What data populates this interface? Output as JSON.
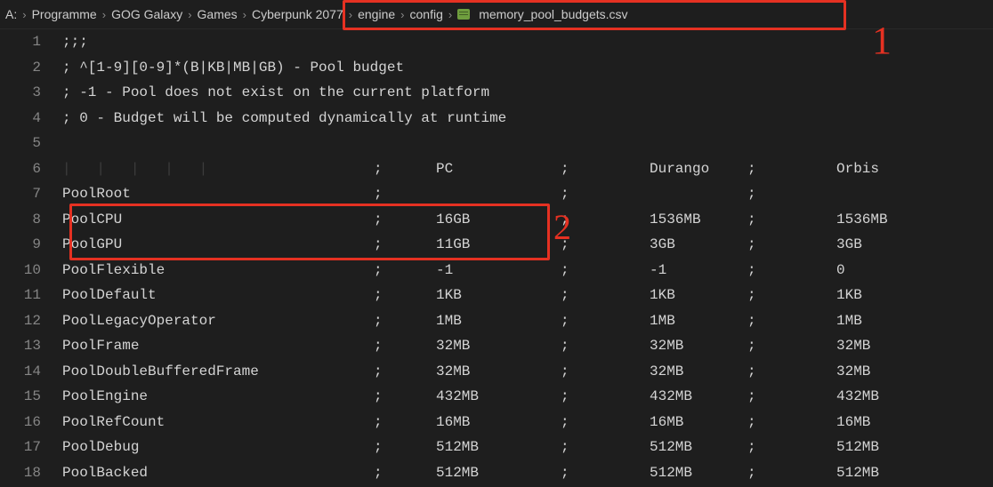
{
  "breadcrumb": {
    "root": "A:",
    "items": [
      "Programme",
      "GOG Galaxy",
      "Games",
      "Cyberpunk 2077",
      "engine",
      "config"
    ],
    "file_icon": "csv-file-icon",
    "file": "memory_pool_budgets.csv",
    "sep_glyph": "›"
  },
  "annotations": {
    "label1": "1",
    "label2": "2"
  },
  "editor": {
    "headers": {
      "pc": "PC",
      "durango": "Durango",
      "orbis": "Orbis"
    },
    "semi": ";",
    "lines_top": [
      ";;;",
      "; ^[1-9][0-9]*(B|KB|MB|GB) - Pool budget",
      "; -1 - Pool does not exist on the current platform",
      "; 0 - Budget will be computed dynamically at runtime",
      ""
    ],
    "whitespace_marks": "|   |   |   |   |",
    "rows": [
      {
        "name": "PoolRoot",
        "pc": "",
        "durango": "",
        "orbis": ""
      },
      {
        "name": "PoolCPU",
        "pc": "16GB",
        "durango": "1536MB",
        "orbis": "1536MB"
      },
      {
        "name": "PoolGPU",
        "pc": "11GB",
        "durango": "3GB",
        "orbis": "3GB"
      },
      {
        "name": "PoolFlexible",
        "pc": "-1",
        "durango": "-1",
        "orbis": "0"
      },
      {
        "name": "PoolDefault",
        "pc": "1KB",
        "durango": "1KB",
        "orbis": "1KB"
      },
      {
        "name": "PoolLegacyOperator",
        "pc": "1MB",
        "durango": "1MB",
        "orbis": "1MB"
      },
      {
        "name": "PoolFrame",
        "pc": "32MB",
        "durango": "32MB",
        "orbis": "32MB"
      },
      {
        "name": "PoolDoubleBufferedFrame",
        "pc": "32MB",
        "durango": "32MB",
        "orbis": "32MB"
      },
      {
        "name": "PoolEngine",
        "pc": "432MB",
        "durango": "432MB",
        "orbis": "432MB"
      },
      {
        "name": "PoolRefCount",
        "pc": "16MB",
        "durango": "16MB",
        "orbis": "16MB"
      },
      {
        "name": "PoolDebug",
        "pc": "512MB",
        "durango": "512MB",
        "orbis": "512MB"
      },
      {
        "name": "PoolBacked",
        "pc": "512MB",
        "durango": "512MB",
        "orbis": "512MB"
      }
    ]
  }
}
